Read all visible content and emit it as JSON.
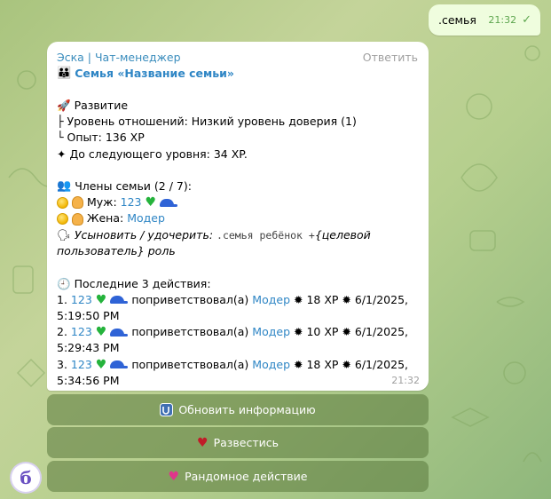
{
  "outgoing": {
    "text": ".семья",
    "time": "21:32"
  },
  "incoming": {
    "sender": "Эска | Чат-менеджер",
    "reply_label": "Ответить",
    "family_title": "Семья «Название семьи»",
    "time": "21:32",
    "development": {
      "header": "Развитие",
      "relation": "├ Уровень отношений: Низкий уровень доверия (1)",
      "exp": "└ Опыт: 136 XP",
      "next": "✦ До следующего уровня: 34 XP."
    },
    "members": {
      "header": "Члены семьи (2 / 7):",
      "husband_label": "Муж:",
      "husband_name": "123",
      "wife_label": "Жена:",
      "wife_name": "Модер",
      "adopt_italic": "Усыновить / удочерить:",
      "adopt_cmd": ".семья ребёнок +",
      "adopt_rest": "{целевой пользователь} роль"
    },
    "actions": {
      "header": "Последние 3 действия:",
      "items": [
        {
          "num": "1.",
          "actor": "123",
          "verb": "поприветствовал(а)",
          "target": "Модер",
          "xp": "18 XP",
          "date": "6/1/2025,",
          "time": "5:19:50 PM"
        },
        {
          "num": "2.",
          "actor": "123",
          "verb": "поприветствовал(а)",
          "target": "Модер",
          "xp": "10 XP",
          "date": "6/1/2025,",
          "time": "5:29:43 PM"
        },
        {
          "num": "3.",
          "actor": "123",
          "verb": "поприветствовал(а)",
          "target": "Модер",
          "xp": "18 XP",
          "date": "6/1/2025,",
          "time": "5:34:56 PM"
        }
      ]
    }
  },
  "buttons": {
    "refresh": "Обновить информацию",
    "divorce": "Развестись",
    "random": "Рандомное действие"
  },
  "avatar_letter": "б",
  "colors": {
    "link": "#2f86c5",
    "outgoing_bg": "#effdde",
    "button_bg": "#5a783c"
  }
}
